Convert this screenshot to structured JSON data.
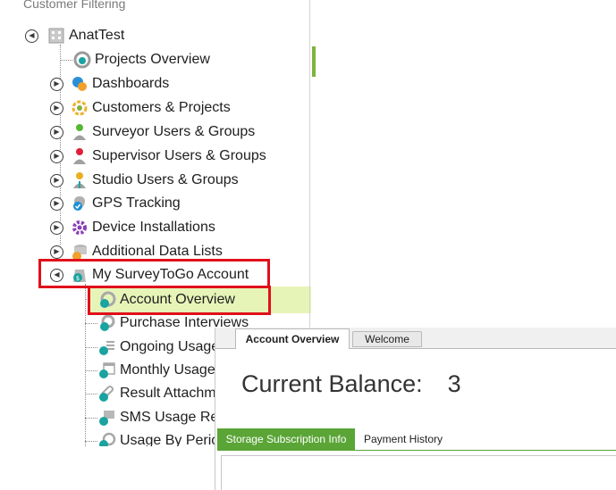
{
  "panel": {
    "header": "Customer Filtering",
    "root_label": "AnatTest",
    "items": [
      {
        "label": "Projects Overview",
        "icon": "projects-overview-icon"
      },
      {
        "label": "Dashboards",
        "icon": "dashboards-icon"
      },
      {
        "label": "Customers & Projects",
        "icon": "customers-projects-icon"
      },
      {
        "label": "Surveyor Users & Groups",
        "icon": "surveyor-user-icon"
      },
      {
        "label": "Supervisor Users & Groups",
        "icon": "supervisor-user-icon"
      },
      {
        "label": "Studio Users & Groups",
        "icon": "studio-user-icon"
      },
      {
        "label": "GPS Tracking",
        "icon": "gps-tracking-icon"
      },
      {
        "label": "Device Installations",
        "icon": "device-installations-icon"
      },
      {
        "label": "Additional Data Lists",
        "icon": "data-lists-icon"
      },
      {
        "label": "My SurveyToGo Account",
        "icon": "account-icon"
      }
    ],
    "account_children": [
      {
        "label": "Account Overview",
        "icon": "account-overview-icon"
      },
      {
        "label": "Purchase Interviews",
        "icon": "purchase-interviews-icon"
      },
      {
        "label": "Ongoing Usage",
        "icon": "ongoing-usage-icon"
      },
      {
        "label": "Monthly Usage",
        "icon": "monthly-usage-icon"
      },
      {
        "label": "Result Attachments",
        "icon": "result-attachments-icon"
      },
      {
        "label": "SMS Usage Report",
        "icon": "sms-usage-icon"
      },
      {
        "label": "Usage By Period",
        "icon": "usage-by-period-icon"
      }
    ]
  },
  "tabs": {
    "account_overview": "Account Overview",
    "welcome": "Welcome"
  },
  "balance": {
    "label": "Current Balance:",
    "value": "3"
  },
  "subtabs": {
    "storage": "Storage Subscription Info",
    "payment": "Payment History"
  },
  "colors": {
    "highlight": "#e7f4b8",
    "annotation": "#e0101b",
    "active_subtab": "#5aa536",
    "accent_teal": "#1aa3a0"
  }
}
